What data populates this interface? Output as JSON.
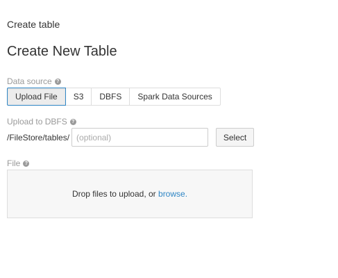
{
  "breadcrumb": "Create table",
  "title": "Create New Table",
  "data_source": {
    "label": "Data source",
    "tabs": [
      {
        "label": "Upload File",
        "active": true
      },
      {
        "label": "S3",
        "active": false
      },
      {
        "label": "DBFS",
        "active": false
      },
      {
        "label": "Spark Data Sources",
        "active": false
      }
    ]
  },
  "upload_to_dbfs": {
    "label": "Upload to DBFS",
    "path_prefix": "/FileStore/tables/",
    "input_value": "",
    "input_placeholder": "(optional)",
    "select_label": "Select"
  },
  "file": {
    "label": "File",
    "drop_text": "Drop files to upload, or ",
    "browse_text": "browse."
  },
  "help_icon_glyph": "?",
  "colors": {
    "accent": "#2f86c5",
    "label": "#999999",
    "dropzone_bg": "#f7f7f7"
  }
}
